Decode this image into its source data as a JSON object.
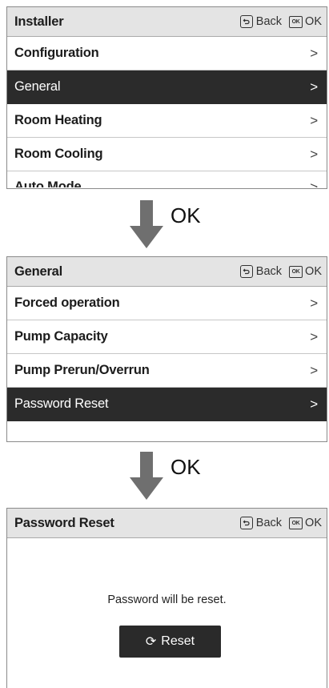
{
  "screen1": {
    "title": "Installer",
    "back_label": "Back",
    "ok_icon": "OK",
    "ok_label": "OK",
    "items": [
      {
        "label": "Configuration",
        "chevron": ">"
      },
      {
        "label": "General",
        "chevron": ">",
        "selected": true
      },
      {
        "label": "Room Heating",
        "chevron": ">"
      },
      {
        "label": "Room Cooling",
        "chevron": ">"
      },
      {
        "label": "Auto Mode",
        "chevron": ">"
      }
    ]
  },
  "arrow1": {
    "label": "OK"
  },
  "screen2": {
    "title": "General",
    "back_label": "Back",
    "ok_icon": "OK",
    "ok_label": "OK",
    "items": [
      {
        "label": "Forced operation",
        "chevron": ">"
      },
      {
        "label": "Pump Capacity",
        "chevron": ">"
      },
      {
        "label": "Pump Prerun/Overrun",
        "chevron": ">"
      },
      {
        "label": "Password Reset",
        "chevron": ">",
        "selected": true
      }
    ]
  },
  "arrow2": {
    "label": "OK"
  },
  "screen3": {
    "title": "Password Reset",
    "back_label": "Back",
    "ok_icon": "OK",
    "ok_label": "OK",
    "message": "Password will be reset.",
    "button_label": "Reset",
    "button_icon": "refresh-icon"
  },
  "colors": {
    "header_bg": "#e4e4e4",
    "selected_bg": "#2b2b2b",
    "button_bg": "#2a2a2a",
    "arrow": "#6f6f6f"
  }
}
